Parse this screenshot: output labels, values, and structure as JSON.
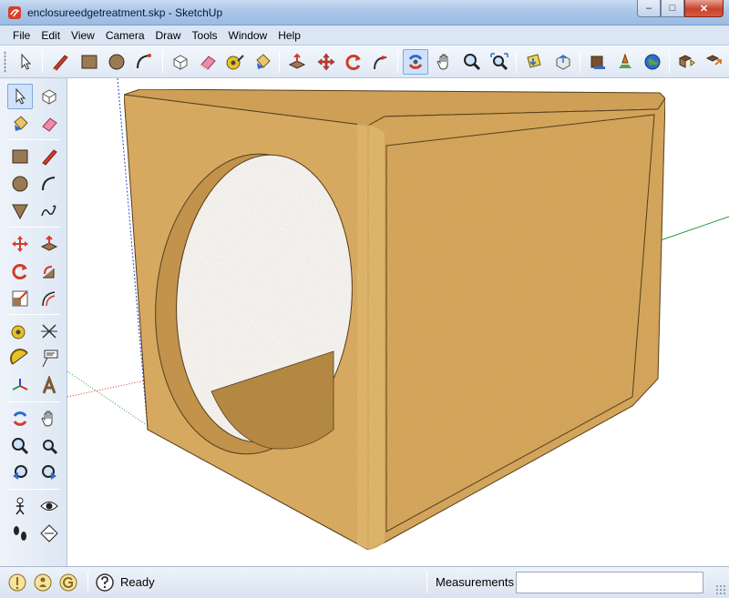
{
  "window": {
    "title": "enclosureedgetreatment.skp - SketchUp",
    "minimize_glyph": "–",
    "maximize_glyph": "□",
    "close_glyph": "✕"
  },
  "menu": {
    "items": [
      "File",
      "Edit",
      "View",
      "Camera",
      "Draw",
      "Tools",
      "Window",
      "Help"
    ]
  },
  "top_toolbar": {
    "tools": [
      "select-icon",
      "line-pencil-icon",
      "rectangle-icon",
      "circle-icon",
      "arc-icon",
      "make-component-icon",
      "eraser-icon",
      "tape-measure-icon",
      "paint-bucket-icon",
      "push-pull-icon",
      "move-icon",
      "rotate-icon",
      "follow-me-icon",
      "orbit-icon",
      "pan-icon",
      "zoom-icon",
      "zoom-extents-icon",
      "get-models-icon",
      "share-model-icon",
      "share-component-icon",
      "place-model-icon",
      "google-earth-icon",
      "components-icon"
    ],
    "active_tool": "orbit-icon"
  },
  "left_toolbar": {
    "tools": [
      "select-icon",
      "make-component-icon",
      "paint-bucket-icon",
      "eraser-icon",
      "rectangle-icon",
      "line-pencil-icon",
      "circle-icon",
      "arc-icon",
      "polygon-icon",
      "freehand-icon",
      "move-icon",
      "push-pull-icon",
      "rotate-icon",
      "follow-me-icon",
      "scale-icon",
      "offset-icon",
      "tape-measure-icon",
      "dimension-icon",
      "protractor-icon",
      "text-icon",
      "axes-icon",
      "3d-text-icon",
      "orbit-icon",
      "pan-icon",
      "zoom-icon",
      "zoom-extents-icon",
      "previous-view-icon",
      "next-view-icon",
      "position-camera-icon",
      "look-around-icon",
      "walk-icon",
      "section-plane-icon"
    ],
    "active_tool": "select-icon"
  },
  "status": {
    "text": "Ready",
    "measurements_label": "Measurements",
    "measurements_value": ""
  },
  "colors": {
    "mdf": "#d9a75c",
    "mdf_light": "#e8bd74",
    "mdf_dark": "#b88a45",
    "axis_red": "#cc2b2b",
    "axis_green": "#2c9a3a",
    "axis_blue": "#2b45cc"
  }
}
